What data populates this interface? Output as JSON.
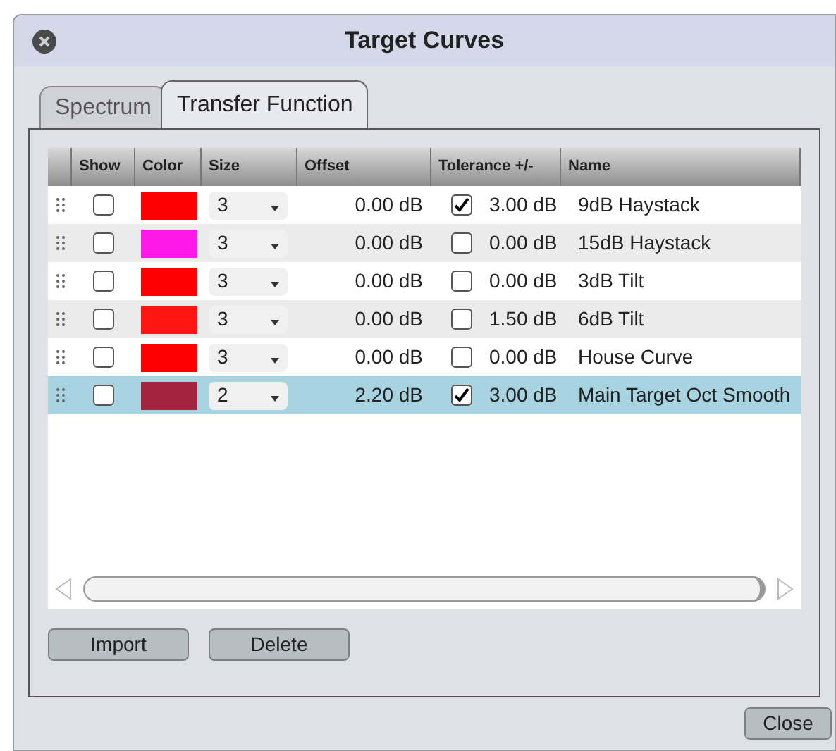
{
  "window": {
    "title": "Target Curves"
  },
  "tabs": [
    {
      "label": "Spectrum",
      "selected": false
    },
    {
      "label": "Transfer Function",
      "selected": true
    }
  ],
  "table": {
    "columns": [
      "Show",
      "Color",
      "Size",
      "Offset",
      "Tolerance +/-",
      "Name"
    ],
    "rows": [
      {
        "show": false,
        "color": "#ff0000",
        "size": "3",
        "offset": "0.00 dB",
        "tolerance_on": true,
        "tolerance": "3.00 dB",
        "name": "9dB Haystack",
        "selected": false
      },
      {
        "show": false,
        "color": "#ff18e8",
        "size": "3",
        "offset": "0.00 dB",
        "tolerance_on": false,
        "tolerance": "0.00 dB",
        "name": "15dB Haystack",
        "selected": false
      },
      {
        "show": false,
        "color": "#ff0000",
        "size": "3",
        "offset": "0.00 dB",
        "tolerance_on": false,
        "tolerance": "0.00 dB",
        "name": "3dB Tilt",
        "selected": false
      },
      {
        "show": false,
        "color": "#ff1414",
        "size": "3",
        "offset": "0.00 dB",
        "tolerance_on": false,
        "tolerance": "1.50 dB",
        "name": "6dB Tilt",
        "selected": false
      },
      {
        "show": false,
        "color": "#ff0000",
        "size": "3",
        "offset": "0.00 dB",
        "tolerance_on": false,
        "tolerance": "0.00 dB",
        "name": "House Curve",
        "selected": false
      },
      {
        "show": false,
        "color": "#a3243f",
        "size": "2",
        "offset": "2.20 dB",
        "tolerance_on": true,
        "tolerance": "3.00 dB",
        "name": "Main Target Oct Smooth",
        "selected": true
      }
    ]
  },
  "buttons": [
    "Import",
    "Delete"
  ],
  "close_button": "Close"
}
